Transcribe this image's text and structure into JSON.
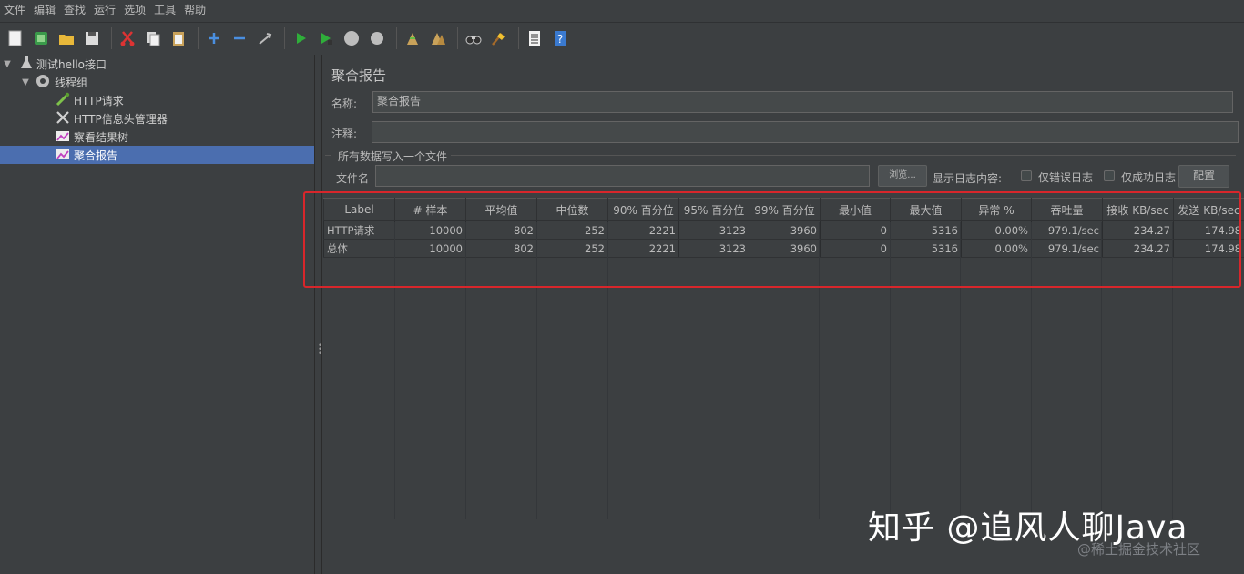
{
  "menu": [
    "文件",
    "编辑",
    "查找",
    "运行",
    "选项",
    "工具",
    "帮助"
  ],
  "toolbar": [
    "new-icon",
    "templates-icon",
    "open-icon",
    "save-icon",
    "cut-icon",
    "copy-icon",
    "paste-icon",
    "expand-icon",
    "collapse-icon",
    "toggle-icon",
    "start-icon",
    "start-no-pause-icon",
    "stop-icon",
    "shutdown-icon",
    "clear-icon",
    "clear-all-icon",
    "search-icon",
    "reset-search-icon",
    "function-helper-icon",
    "help-icon"
  ],
  "tree": {
    "root": "测试hello接口",
    "thread_group": "线程组",
    "items": [
      "HTTP请求",
      "HTTP信息头管理器",
      "察看结果树",
      "聚合报告"
    ]
  },
  "panel": {
    "title": "聚合报告",
    "name_label": "名称:",
    "name_value": "聚合报告",
    "comment_label": "注释:",
    "comment_value": "",
    "group_title": "所有数据写入一个文件",
    "file_label": "文件名",
    "file_value": "",
    "browse_button": "浏览...",
    "log_label": "显示日志内容:",
    "errors_only": "仅错误日志",
    "success_only": "仅成功日志",
    "config_button": "配置"
  },
  "table": {
    "headers": [
      "Label",
      "# 样本",
      "平均值",
      "中位数",
      "90% 百分位",
      "95% 百分位",
      "99% 百分位",
      "最小值",
      "最大值",
      "异常 %",
      "吞吐量",
      "接收 KB/sec",
      "发送 KB/sec"
    ],
    "rows": [
      [
        "HTTP请求",
        "10000",
        "802",
        "252",
        "2221",
        "3123",
        "3960",
        "0",
        "5316",
        "0.00%",
        "979.1/sec",
        "234.27",
        "174.98"
      ],
      [
        "总体",
        "10000",
        "802",
        "252",
        "2221",
        "3123",
        "3960",
        "0",
        "5316",
        "0.00%",
        "979.1/sec",
        "234.27",
        "174.98"
      ]
    ]
  },
  "watermark": {
    "main": "知乎 @追风人聊Java",
    "sub": "@稀土掘金技术社区"
  },
  "colors": {
    "highlight": "#d8262b",
    "selection": "#4b6eaf"
  }
}
